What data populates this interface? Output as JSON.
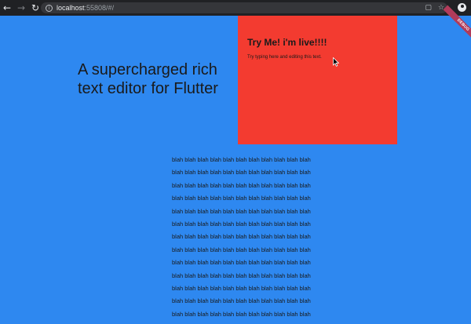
{
  "browser": {
    "url_host": "localhost",
    "url_rest": ":55808/#/",
    "nav": {
      "back": "←",
      "forward": "→",
      "reload": "↻"
    },
    "debug_banner": "DEBUG",
    "icons": [
      "back-icon",
      "forward-icon",
      "reload-icon",
      "info-icon",
      "extension-icon",
      "star-icon",
      "profile-icon"
    ]
  },
  "page": {
    "hero_text": "A supercharged rich text editor for Flutter",
    "editor": {
      "heading": "Try Me! i'm live!!!!",
      "body": "Try typing here and editing this text."
    },
    "filler_lines": [
      "blah blah blah blah blah blah blah blah blah blah blah",
      "blah blah blah blah blah blah blah blah blah blah blah",
      "blah blah blah blah blah blah blah blah blah blah blah",
      "blah blah blah blah blah blah blah blah blah blah blah",
      "blah blah blah blah blah blah blah blah blah blah blah",
      "blah blah blah blah blah blah blah blah blah blah blah",
      "blah blah blah blah blah blah blah blah blah blah blah",
      "blah blah blah blah blah blah blah blah blah blah blah",
      "blah blah blah blah blah blah blah blah blah blah blah",
      "blah blah blah blah blah blah blah blah blah blah blah",
      "blah blah blah blah blah blah blah blah blah blah blah",
      "blah blah blah blah blah blah blah blah blah blah blah",
      "blah blah blah blah blah blah blah blah blah blah blah"
    ]
  },
  "colors": {
    "page_background": "#2e88f0",
    "editor_background": "#f33b30",
    "browser_chrome": "#202124"
  }
}
